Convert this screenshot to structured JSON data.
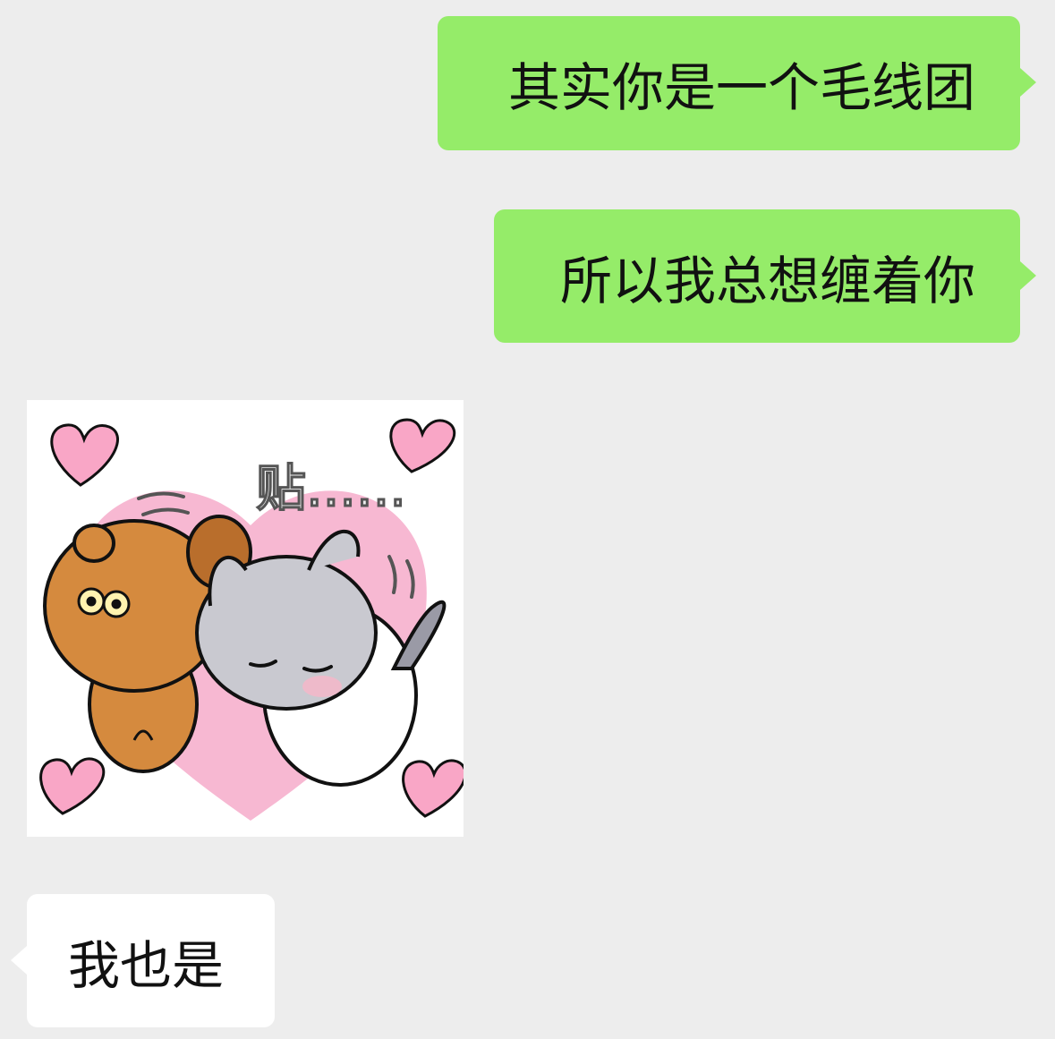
{
  "chat": {
    "background": "#ededed",
    "outgoing_bubble_color": "#95ec69",
    "incoming_bubble_color": "#ffffff",
    "messages": [
      {
        "direction": "outgoing",
        "type": "text",
        "text": "其实你是一个毛线团"
      },
      {
        "direction": "outgoing",
        "type": "text",
        "text": "所以我总想缠着你"
      },
      {
        "direction": "incoming",
        "type": "sticker",
        "sticker_text": "贴……"
      },
      {
        "direction": "incoming",
        "type": "text",
        "text": "我也是"
      }
    ]
  }
}
